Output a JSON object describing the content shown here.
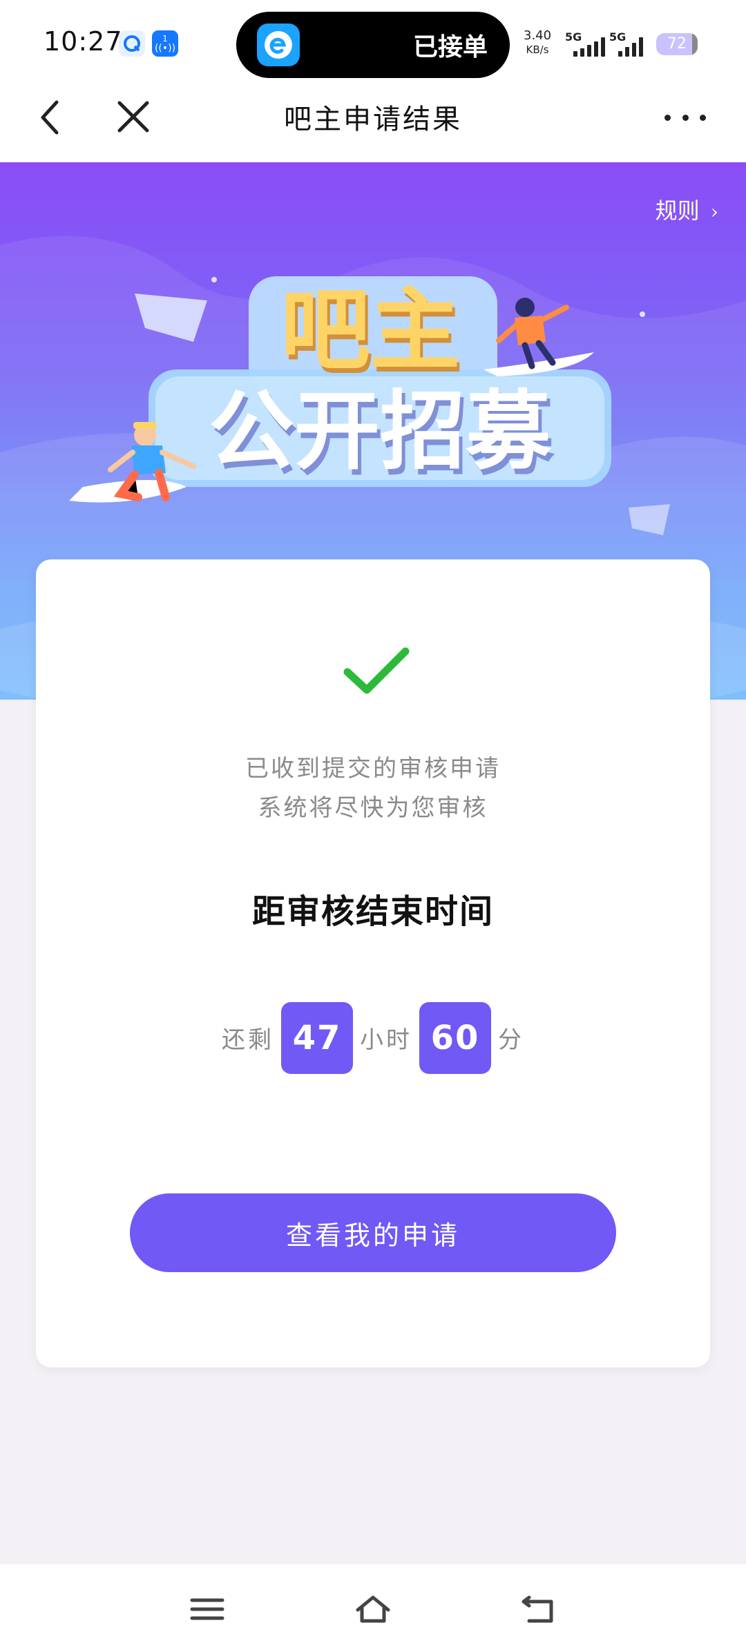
{
  "status_bar": {
    "time": "10:27",
    "notification_app": "已接单",
    "net_speed_value": "3.40",
    "net_speed_unit": "KB/s",
    "signal1": "5G",
    "signal2": "5G",
    "battery": "72"
  },
  "nav": {
    "title": "吧主申请结果",
    "back_icon": "chevron-left-icon",
    "close_icon": "close-icon",
    "more_icon": "more-dots-icon"
  },
  "banner": {
    "rules_label": "规则",
    "headline_top": "吧主",
    "headline_bottom": "公开招募"
  },
  "result_card": {
    "message_line1": "已收到提交的审核申请",
    "message_line2": "系统将尽快为您审核",
    "countdown_title": "距审核结束时间",
    "remaining_label": "还剩",
    "hours_value": "47",
    "hours_label": "小时",
    "minutes_value": "60",
    "minutes_label": "分",
    "view_button": "查看我的申请"
  },
  "bottom_nav": {
    "menu_icon": "menu-icon",
    "home_icon": "home-icon",
    "back_icon": "back-icon"
  },
  "colors": {
    "accent": "#7159f5",
    "success": "#2dba3a",
    "banner_top": "#8b4cf6",
    "banner_bottom": "#65b2fc"
  }
}
